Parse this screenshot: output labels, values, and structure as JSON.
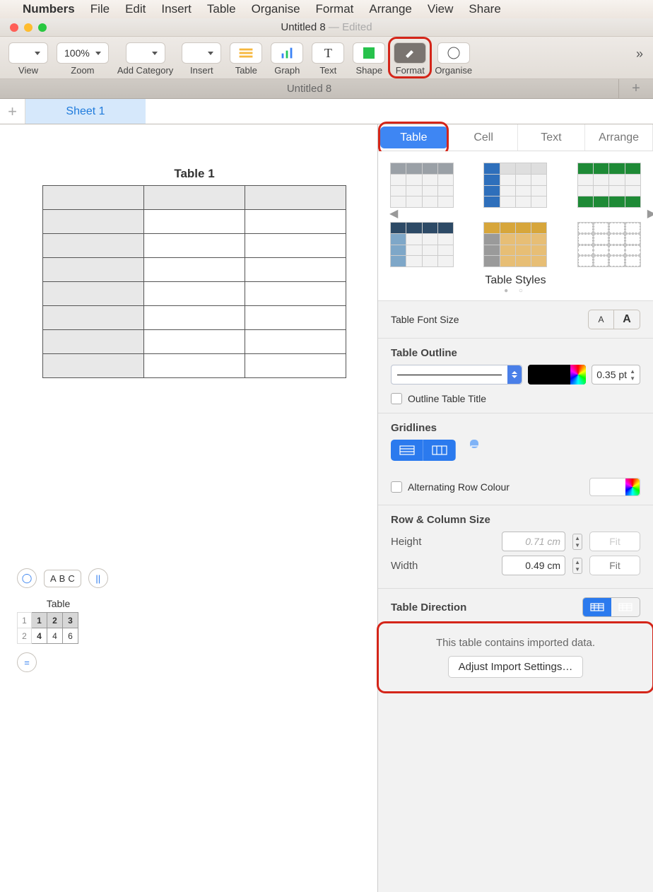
{
  "menubar": {
    "app": "Numbers",
    "items": [
      "File",
      "Edit",
      "Insert",
      "Table",
      "Organise",
      "Format",
      "Arrange",
      "View",
      "Share"
    ]
  },
  "window": {
    "title": "Untitled 8",
    "status": "— Edited"
  },
  "toolbar": {
    "view": "View",
    "zoom_value": "100%",
    "zoom": "Zoom",
    "addcat": "Add Category",
    "insert": "Insert",
    "table": "Table",
    "graph": "Graph",
    "text": "Text",
    "shape": "Shape",
    "format": "Format",
    "organise": "Organise"
  },
  "doctab": "Untitled 8",
  "sheet": "Sheet 1",
  "canvas": {
    "table_title": "Table 1",
    "mini": {
      "title": "Table",
      "abc": [
        "A",
        "B",
        "C"
      ],
      "row1": [
        "1",
        "2",
        "3"
      ],
      "row2": [
        "4",
        "4",
        "6"
      ],
      "nums": [
        "1",
        "2"
      ]
    }
  },
  "inspector": {
    "tabs": {
      "table": "Table",
      "cell": "Cell",
      "text": "Text",
      "arrange": "Arrange"
    },
    "styles_label": "Table Styles",
    "font_size": "Table Font Size",
    "outline": {
      "title": "Table Outline",
      "pt": "0.35 pt",
      "checkbox": "Outline Table Title"
    },
    "gridlines": "Gridlines",
    "altrow": "Alternating Row Colour",
    "rowcol": {
      "title": "Row & Column Size",
      "height": "Height",
      "height_val": "0.71 cm",
      "width": "Width",
      "width_val": "0.49 cm",
      "fit": "Fit"
    },
    "direction": "Table Direction",
    "import": {
      "msg": "This table contains imported data.",
      "btn": "Adjust Import Settings…"
    }
  }
}
